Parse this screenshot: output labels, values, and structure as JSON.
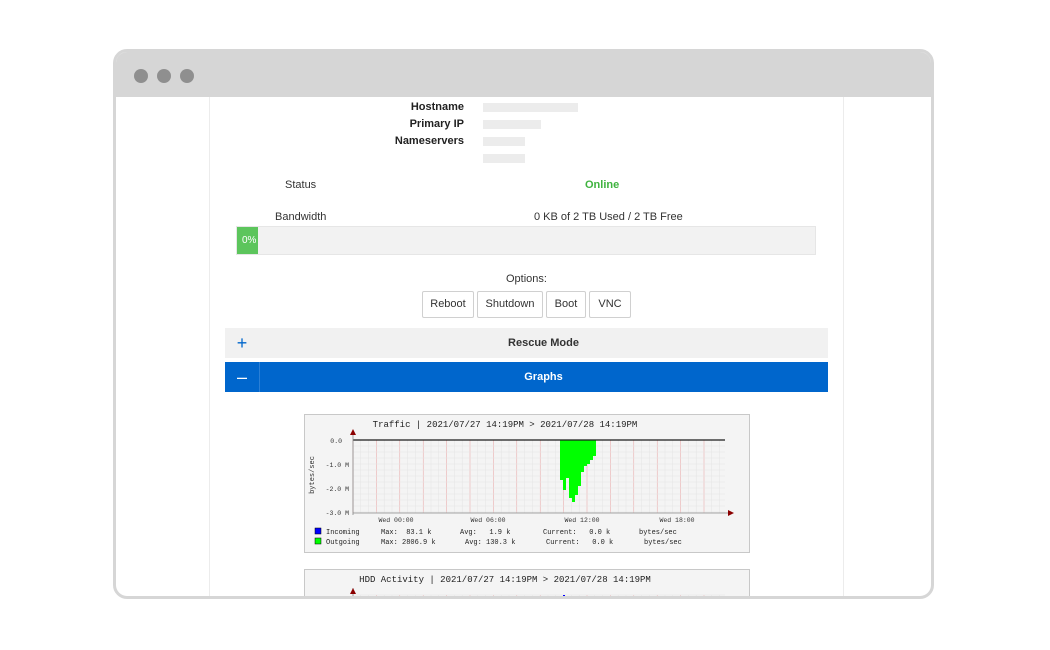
{
  "server": {
    "hostname_label": "Hostname",
    "primary_ip_label": "Primary IP",
    "nameservers_label": "Nameservers",
    "status_label": "Status",
    "status_value": "Online",
    "bandwidth_label": "Bandwidth",
    "bandwidth_value": "0 KB of 2 TB Used / 2 TB Free",
    "bandwidth_percent_text": "0%",
    "bandwidth_percent": 0
  },
  "options": {
    "label": "Options:",
    "buttons": [
      "Reboot",
      "Shutdown",
      "Boot",
      "VNC"
    ]
  },
  "accordion": {
    "rescue": {
      "icon": "plus-icon",
      "label": "Rescue Mode"
    },
    "graphs": {
      "icon": "minus-icon",
      "label": "Graphs"
    }
  },
  "colors": {
    "accent": "#0066cc",
    "online": "#3fb33f",
    "incoming": "#0000ff",
    "outgoing": "#00ff00"
  },
  "traffic_graph": {
    "title": "Traffic | 2021/07/27 14:19PM > 2021/07/28 14:19PM",
    "y_axis_label": "bytes/sec",
    "y_ticks": [
      "0.0",
      "-1.0 M",
      "-2.0 M",
      "-3.0 M"
    ],
    "x_ticks": [
      "Wed 00:00",
      "Wed 06:00",
      "Wed 12:00",
      "Wed 18:00"
    ],
    "legend": [
      {
        "name": "Incoming",
        "max": "Max:  83.1 k",
        "avg": "Avg:   1.9 k",
        "current": "Current:   0.0 k",
        "unit": "bytes/sec"
      },
      {
        "name": "Outgoing",
        "max": "Max: 2806.9 k",
        "avg": "Avg: 130.3 k",
        "current": "Current:   0.0 k",
        "unit": "bytes/sec"
      }
    ]
  },
  "hdd_graph": {
    "title": "HDD Activity | 2021/07/27 14:19PM > 2021/07/28 14:19PM"
  }
}
